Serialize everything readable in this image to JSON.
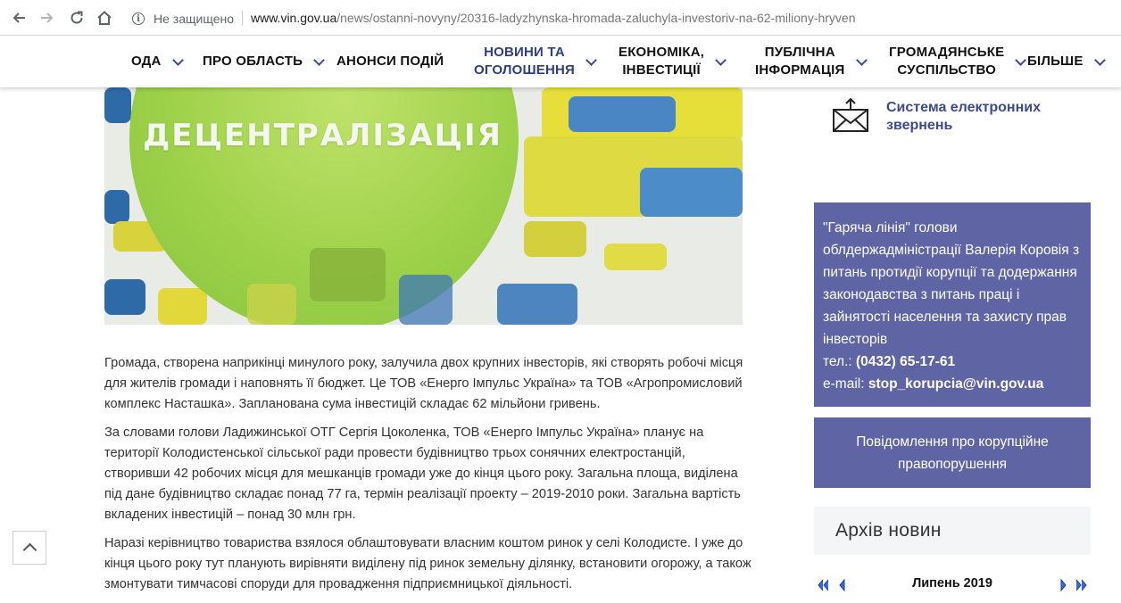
{
  "browser": {
    "security_label": "Не защищено",
    "url_host": "www.vin.gov.ua",
    "url_path": "/news/ostanni-novyny/20316-ladyzhynska-hromada-zaluchyla-investoriv-na-62-miliony-hryven"
  },
  "nav": {
    "items": [
      {
        "label": "ОДА"
      },
      {
        "label": "ПРО ОБЛАСТЬ"
      },
      {
        "label": "АНОНСИ ПОДІЙ"
      },
      {
        "label_line1": "НОВИНИ ТА",
        "label_line2": "ОГОЛОШЕННЯ"
      },
      {
        "label_line1": "ЕКОНОМІКА,",
        "label_line2": "ІНВЕСТИЦІЇ"
      },
      {
        "label_line1": "ПУБЛІЧНА",
        "label_line2": "ІНФОРМАЦІЯ"
      },
      {
        "label_line1": "ГРОМАДЯНСЬКЕ",
        "label_line2": "СУСПІЛЬСТВО"
      },
      {
        "label": "БІЛЬШЕ"
      }
    ],
    "active_color": "#2e3e7e"
  },
  "hero": {
    "title": "ДЕЦЕНТРАЛІЗАЦІЯ"
  },
  "article": {
    "p1": "Громада, створена наприкінці минулого року, залучила двох крупних інвесторів, які створять робочі місця для жителів громади і наповнять її бюджет. Це ТОВ «Енерго Імпульс Україна» та ТОВ «Агропромисловий комплекс Насташка». Запланована сума інвестицій  складає 62 мільйони гривень.",
    "p2": "За словами голови Ладижинської ОТГ Сергія Цоколенка, ТОВ «Енерго Імпульс Україна» планує на території  Колодистенської сільської ради провести будівництво трьох сонячних електростанцій, створивши 42 робочих місця для мешканців громади уже до кінця цього року. Загальна площа, виділена під дане будівництво складає понад 77 га, термін реалізації проекту – 2019-2010 роки. Загальна вартість вкладених інвестицій – понад 30 млн грн.",
    "p3": "Наразі керівництво товариства взялося облаштовувати власним коштом ринок у селі Колодисте. І уже до кінця цього року тут планують вирівняти виділену під ринок земельну ділянку, встановити огорожу, а також змонтувати тимчасові споруди для провадження підприємницької діяльності."
  },
  "sidebar": {
    "appeal_line1": "Система електронних",
    "appeal_line2": "звернень",
    "hotline": {
      "text": "\"Гаряча лінія\" голови облдержадміністрації Валерія Коровія з питань протидії корупції та додержання законодавства з питань праці і зайнятості населення та захисту прав інвесторів",
      "phone_label": "тел.:",
      "phone": "(0432) 65-17-61",
      "email_label": "e-mail:",
      "email": "stop_korupcia@vin.gov.ua"
    },
    "report_label": "Повідомлення про корупційне правопорушення",
    "archive_title": "Архів новин",
    "calendar_month": "Липень 2019"
  },
  "colors": {
    "sidebar_box": "#5e64a4",
    "link": "#3d4a8f"
  }
}
